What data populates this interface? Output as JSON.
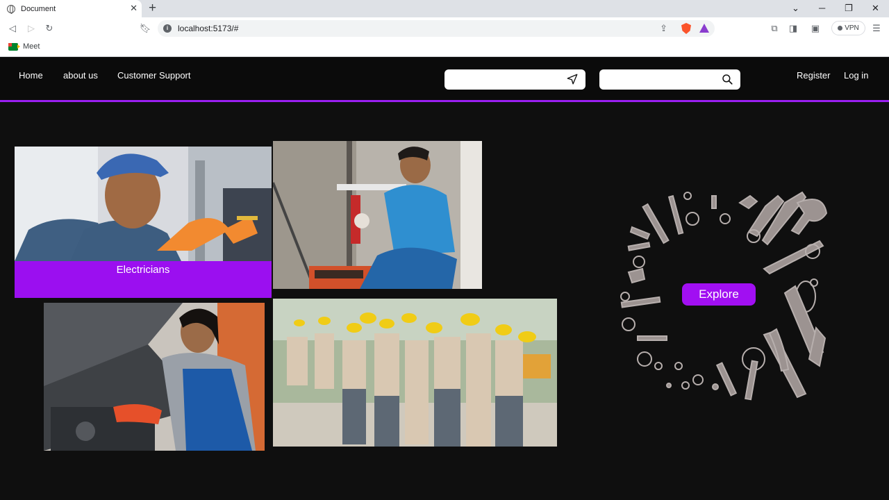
{
  "browser": {
    "tab_title": "Document",
    "url": "localhost:5173/#",
    "vpn_label": "VPN",
    "bookmark": "Meet"
  },
  "nav": {
    "links": [
      "Home",
      "about us",
      "Customer Support"
    ],
    "register": "Register",
    "login": "Log in",
    "accent": "#9a1ff0"
  },
  "hero": {
    "caption": "Electricians",
    "cta": "Explore",
    "images": [
      "electrician",
      "plumber",
      "mechanic",
      "workers-group",
      "tools-ring"
    ]
  },
  "icons": {
    "location": "send-location-icon",
    "search": "search-icon"
  }
}
